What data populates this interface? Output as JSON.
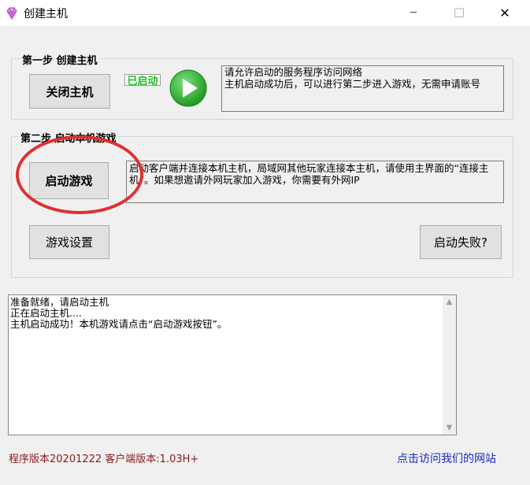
{
  "window": {
    "title": "创建主机",
    "min_glyph": "─",
    "max_glyph": "☐",
    "close_glyph": "✕"
  },
  "step1": {
    "label": "第一步 创建主机",
    "close_host_button": "关闭主机",
    "status": "已启动",
    "status_color": "#1fbf1f",
    "info": "请允许启动的服务程序访问网络\n主机启动成功后，可以进行第二步进入游戏，无需申请账号"
  },
  "step2": {
    "label": "第二步 启动本机游戏",
    "start_game_button": "启动游戏",
    "info": "启动客户端并连接本机主机，局域网其他玩家连接本主机，请使用主界面的“连接主机”。如果想邀请外网玩家加入游戏，你需要有外网IP",
    "game_settings_button": "游戏设置",
    "launch_failed_button": "启动失败?"
  },
  "log": {
    "lines": [
      "准备就绪，请启动主机",
      "正在启动主机....",
      "主机启动成功！本机游戏请点击“启动游戏按钮”。"
    ]
  },
  "footer": {
    "version": "程序版本20201222 客户端版本:1.03H+",
    "website_link": "点击访问我们的网站"
  },
  "colors": {
    "annotation_circle": "#e03030",
    "play_icon": "#2db52d",
    "link": "#1a28c8",
    "version_text": "#8b1a1a"
  },
  "icons": {
    "app": "gem-icon",
    "play": "play-icon"
  }
}
